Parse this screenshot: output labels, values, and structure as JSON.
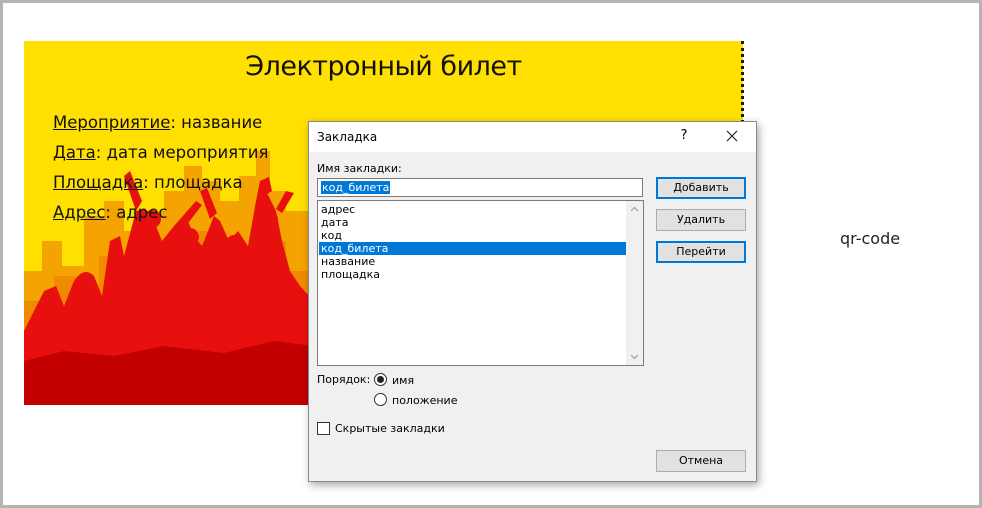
{
  "ticket": {
    "title": "Электронный билет",
    "fields": [
      {
        "label": "Мероприятие",
        "value": ": название"
      },
      {
        "label": "Дата",
        "value": ": дата мероприятия"
      },
      {
        "label": "Площадка",
        "value": ": площадка"
      },
      {
        "label": "Адрес",
        "value": ": адрес"
      }
    ],
    "qr_placeholder": "qr-code"
  },
  "dialog": {
    "title": "Закладка",
    "help_label": "?",
    "name_label": "Имя закладки:",
    "name_value": "код_билета",
    "bookmarks": [
      "адрес",
      "дата",
      "код",
      "код_билета",
      "название",
      "площадка"
    ],
    "selected_bookmark": "код_билета",
    "buttons": {
      "add": "Добавить",
      "delete": "Удалить",
      "goto": "Перейти",
      "cancel": "Отмена"
    },
    "order_label": "Порядок:",
    "order_options": [
      "имя",
      "положение"
    ],
    "order_selected": "имя",
    "hidden_label": "Скрытые закладки",
    "hidden_checked": false
  },
  "colors": {
    "ticket_bg": "#ffe000",
    "crowd_red": "#e8100f",
    "city_orange": "#f5a300",
    "selection": "#0078d7"
  }
}
